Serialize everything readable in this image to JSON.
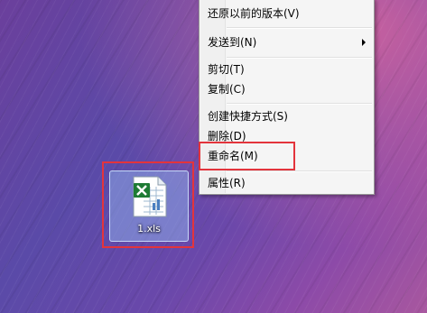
{
  "desktop": {
    "file": {
      "name": "1.xls",
      "icon": "excel-file-icon",
      "icon_color": "#1e7b34"
    }
  },
  "context_menu": {
    "items": [
      {
        "label": "还原以前的版本(V)"
      },
      {
        "label": "发送到(N)",
        "submenu_icon": "chevron-right-icon"
      },
      {
        "label": "剪切(T)"
      },
      {
        "label": "复制(C)"
      },
      {
        "label": "创建快捷方式(S)"
      },
      {
        "label": "删除(D)"
      },
      {
        "label": "重命名(M)"
      },
      {
        "label": "属性(R)"
      }
    ]
  },
  "highlight_color": "#e3343c"
}
